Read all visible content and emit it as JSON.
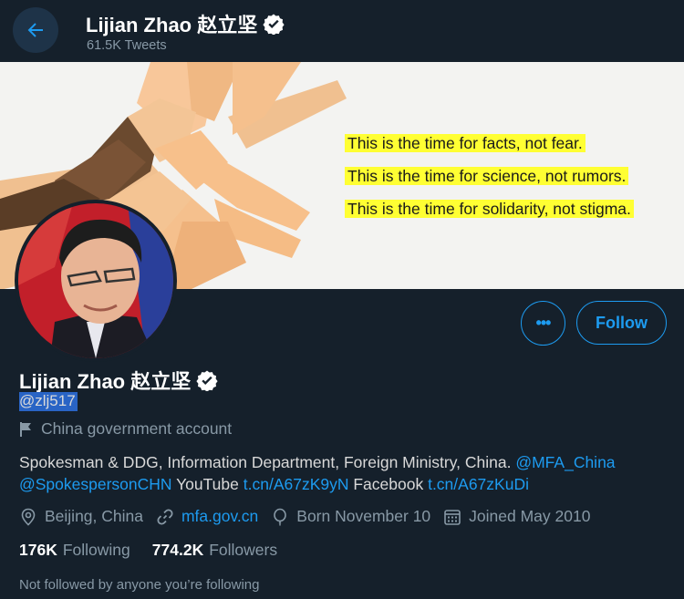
{
  "header": {
    "back_icon": "arrow-left-icon",
    "title": "Lijian Zhao 赵立坚",
    "tweet_count": "61.5K Tweets"
  },
  "banner": {
    "lines": [
      "This is the time for facts, not fear.",
      "This is the time for science, not rumors.",
      "This is the time for solidarity, not stigma."
    ]
  },
  "profile": {
    "name": "Lijian Zhao 赵立坚",
    "handle": "@zlj517",
    "label": "China government account",
    "bio_parts": [
      {
        "text": "Spokesman & DDG, Information Department, Foreign Ministry, China. ",
        "link": false
      },
      {
        "text": "@MFA_China",
        "link": true
      },
      {
        "text": " ",
        "link": false
      },
      {
        "text": "@SpokespersonCHN",
        "link": true
      },
      {
        "text": " YouTube ",
        "link": false
      },
      {
        "text": "t.cn/A67zK9yN",
        "link": true
      },
      {
        "text": " Facebook ",
        "link": false
      },
      {
        "text": "t.cn/A67zKuDi",
        "link": true
      }
    ],
    "location": "Beijing, China",
    "website": "mfa.gov.cn",
    "born": "Born November 10",
    "joined": "Joined May 2010",
    "following_count": "176K",
    "following_label": "Following",
    "followers_count": "774.2K",
    "followers_label": "Followers",
    "not_followed": "Not followed by anyone you’re following"
  },
  "actions": {
    "more_label": "•••",
    "follow_label": "Follow"
  },
  "colors": {
    "background": "#15202b",
    "accent": "#1d9bf0",
    "muted": "#8899a6",
    "highlight": "#ffff33"
  }
}
